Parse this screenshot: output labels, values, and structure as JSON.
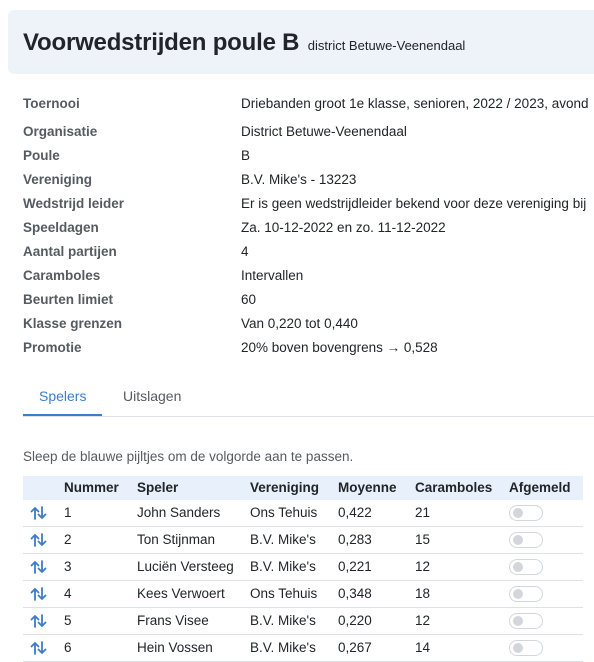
{
  "header": {
    "title": "Voorwedstrijden poule B",
    "subtitle": "district Betuwe-Veenendaal"
  },
  "details": [
    {
      "label": "Toernooi",
      "value": "Driebanden groot 1e klasse, senioren, 2022 / 2023, avond"
    },
    {
      "label": "Organisatie",
      "value": "District Betuwe-Veenendaal"
    },
    {
      "label": "Poule",
      "value": "B"
    },
    {
      "label": "Vereniging",
      "value": "B.V. Mike's - 13223"
    },
    {
      "label": "Wedstrijd leider",
      "value": "Er is geen wedstrijdleider bekend voor deze vereniging bij"
    },
    {
      "label": "Speeldagen",
      "value": "Za. 10-12-2022 en zo. 11-12-2022"
    },
    {
      "label": "Aantal partijen",
      "value": "4"
    },
    {
      "label": "Caramboles",
      "value": "Intervallen"
    },
    {
      "label": "Beurten limiet",
      "value": "60"
    },
    {
      "label": "Klasse grenzen",
      "value": "Van 0,220 tot 0,440"
    },
    {
      "label": "Promotie",
      "value": "20% boven bovengrens → 0,528"
    }
  ],
  "tabs": [
    {
      "label": "Spelers",
      "active": true
    },
    {
      "label": "Uitslagen",
      "active": false
    }
  ],
  "hint": "Sleep de blauwe pijltjes om de volgorde aan te passen.",
  "table": {
    "headers": [
      "Nummer",
      "Speler",
      "Vereniging",
      "Moyenne",
      "Caramboles",
      "Afgemeld"
    ],
    "rows": [
      {
        "nummer": "1",
        "speler": "John Sanders",
        "vereniging": "Ons Tehuis",
        "moyenne": "0,422",
        "caramboles": "21",
        "afgemeld": false
      },
      {
        "nummer": "2",
        "speler": "Ton Stijnman",
        "vereniging": "B.V. Mike's",
        "moyenne": "0,283",
        "caramboles": "15",
        "afgemeld": false
      },
      {
        "nummer": "3",
        "speler": "Luciën Versteeg",
        "vereniging": "B.V. Mike's",
        "moyenne": "0,221",
        "caramboles": "12",
        "afgemeld": false
      },
      {
        "nummer": "4",
        "speler": "Kees Verwoert",
        "vereniging": "Ons Tehuis",
        "moyenne": "0,348",
        "caramboles": "18",
        "afgemeld": false
      },
      {
        "nummer": "5",
        "speler": "Frans Visee",
        "vereniging": "B.V. Mike's",
        "moyenne": "0,220",
        "caramboles": "12",
        "afgemeld": false
      },
      {
        "nummer": "6",
        "speler": "Hein Vossen",
        "vereniging": "B.V. Mike's",
        "moyenne": "0,267",
        "caramboles": "14",
        "afgemeld": false
      }
    ]
  },
  "colors": {
    "accent": "#3d7cc9",
    "header_bg": "#eef3fa",
    "table_head_bg": "#e8f0fb",
    "label": "#555b61"
  },
  "icons": {
    "drag": "swap-vertical-arrows-icon"
  }
}
